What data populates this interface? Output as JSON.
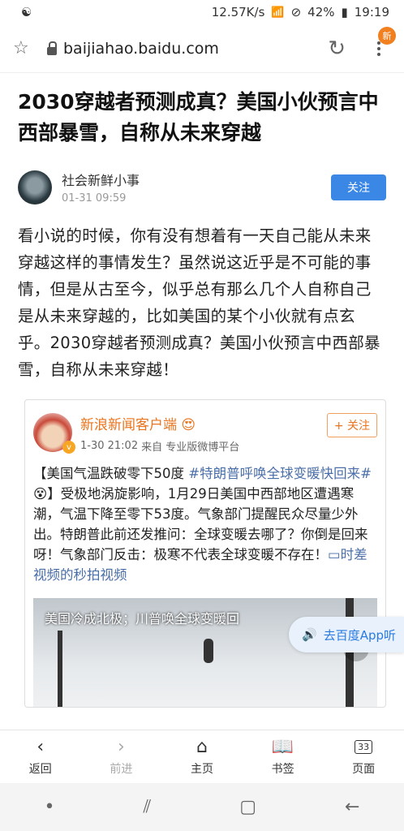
{
  "status": {
    "speed": "12.57K/s",
    "battery": "42%",
    "time": "19:19"
  },
  "browser": {
    "url": "baijiahao.baidu.com",
    "badge": "新"
  },
  "article": {
    "title": "2030穿越者预测成真？美国小伙预言中西部暴雪，自称从未来穿越",
    "author": "社会新鲜小事",
    "time": "01-31 09:59",
    "follow": "关注",
    "body": "看小说的时候，你有没有想着有一天自己能从未来穿越这样的事情发生？虽然说这近乎是不可能的事情，但是从古至今，似乎总有那么几个人自称自己是从未来穿越的，比如美国的某个小伙就有点玄乎。2030穿越者预测成真？美国小伙预言中西部暴雪，自称从未来穿越！"
  },
  "card": {
    "name": "新浪新闻客户端",
    "time": "1-30 21:02",
    "source": "来自 专业版微博平台",
    "follow": "+ 关注",
    "text_1": "【美国气温跌破零下50度 ",
    "hashtag": "#特朗普呼唤全球变暖快回来#",
    "text_2": "】受极地涡旋影响，1月29日美国中西部地区遭遇寒潮，气温下降至零下53度。气象部门提醒民众尽量少外出。特朗普此前还发推问：全球变暖去哪了？你倒是回来呀！气象部门反击：极寒不代表全球变暖不存在！",
    "link": "时差视频的秒拍视频",
    "video_caption": "美国冷成北极；川普唤全球变暖回"
  },
  "listen_button": "去百度App听",
  "toolbar": {
    "back": "返回",
    "forward": "前进",
    "home": "主页",
    "bookmarks": "书签",
    "pages": "页面",
    "page_count": "33"
  }
}
